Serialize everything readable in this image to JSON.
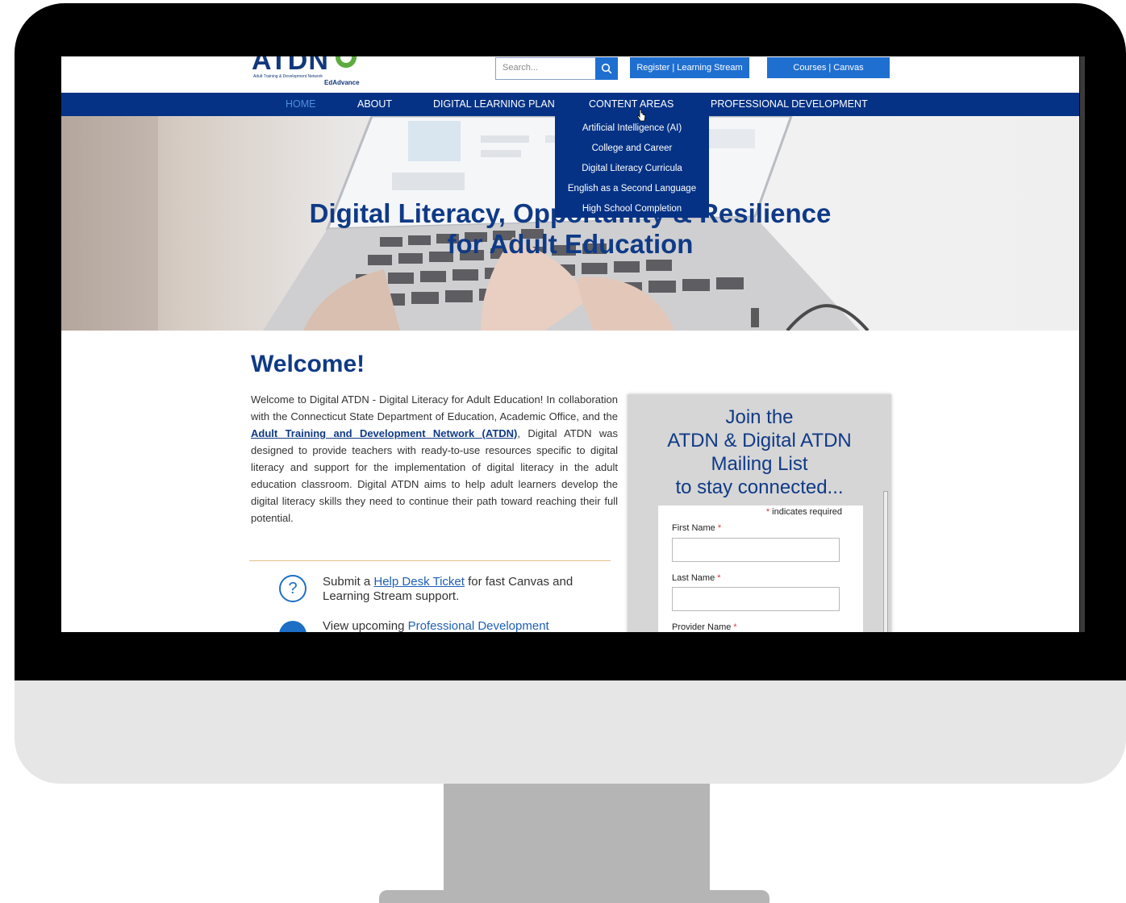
{
  "logo": {
    "name": "ATDN",
    "subtitle": "Adult Training & Development Network",
    "partner": "EdAdvance"
  },
  "header": {
    "search_placeholder": "Search...",
    "register_label": "Register | Learning Stream",
    "courses_label": "Courses | Canvas"
  },
  "nav": {
    "items": [
      "HOME",
      "ABOUT",
      "DIGITAL LEARNING PLAN",
      "CONTENT AREAS",
      "PROFESSIONAL DEVELOPMENT"
    ],
    "active": "HOME",
    "open_menu": "CONTENT AREAS"
  },
  "dropdown": {
    "items": [
      "Artificial Intelligence (AI)",
      "College and Career",
      "Digital Literacy Curricula",
      "English as a Second Language",
      "High School Completion"
    ]
  },
  "hero": {
    "line1": "Digital Literacy, Opportunity & Resilience",
    "line2": "for Adult Education"
  },
  "welcome": {
    "heading": "Welcome!",
    "text_before": "Welcome to Digital ATDN - Digital Literacy for Adult Education! In collaboration with the Connecticut State Department of Education, Academic Office, and the ",
    "link": "Adult Training and Development Network (ATDN)",
    "text_after": ", Digital ATDN was designed to provide teachers with ready-to-use resources specific to digital literacy and support for the implementation of digital literacy in the adult education classroom. Digital ATDN aims to help adult learners develop the digital literacy skills they need to continue their path toward reaching their full potential."
  },
  "help": {
    "before": "Submit a ",
    "link": "Help Desk Ticket",
    "after": " for fast Canvas and Learning Stream support."
  },
  "pd": {
    "before": "View upcoming ",
    "link": "Professional Development"
  },
  "signup": {
    "title_lines": [
      "Join the",
      "ATDN & Digital ATDN",
      "Mailing List",
      "to stay connected..."
    ],
    "required_marker": "*",
    "required_note": "indicates required",
    "fields": [
      "First Name",
      "Last Name",
      "Provider Name"
    ]
  },
  "colors": {
    "navy": "#053285",
    "brand_blue": "#0f3a86",
    "button_blue": "#1f6fd1",
    "active_nav": "#4f8de0",
    "required_red": "#e0343c"
  }
}
